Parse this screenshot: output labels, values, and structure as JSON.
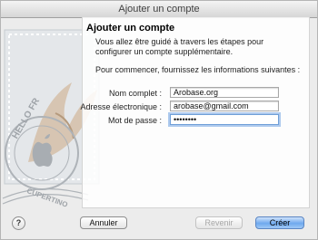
{
  "window": {
    "title": "Ajouter un compte"
  },
  "stamp_text": [
    "HELLO FR",
    "CUPERTINO"
  ],
  "content": {
    "heading": "Ajouter un compte",
    "description": "Vous allez être guidé à travers les étapes pour configurer un compte supplémentaire.",
    "prompt": "Pour commencer, fournissez les informations suivantes :"
  },
  "form": {
    "full_name_label": "Nom complet :",
    "full_name_value": "Arobase.org",
    "email_label": "Adresse électronique :",
    "email_value": "arobase@gmail.com",
    "password_label": "Mot de passe :",
    "password_value": "••••••••"
  },
  "buttons": {
    "help": "?",
    "cancel": "Annuler",
    "back": "Revenir",
    "create": "Créer"
  }
}
